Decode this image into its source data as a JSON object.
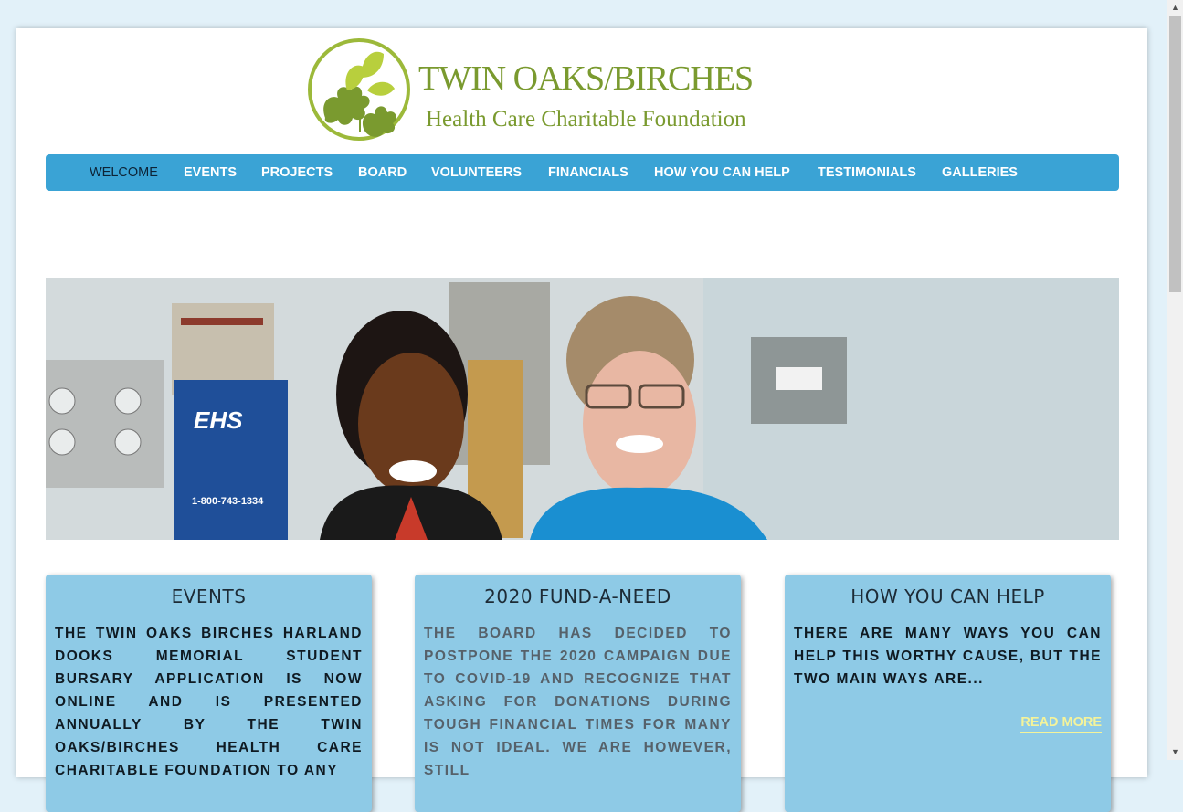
{
  "logo": {
    "title": "TWIN OAKS/BIRCHES",
    "subtitle": "Health Care Charitable Foundation"
  },
  "nav": {
    "items": [
      {
        "label": "WELCOME",
        "active": true
      },
      {
        "label": "EVENTS"
      },
      {
        "label": "PROJECTS"
      },
      {
        "label": "BOARD"
      },
      {
        "label": "VOLUNTEERS"
      },
      {
        "label": "FINANCIALS"
      },
      {
        "label": "HOW YOU CAN HELP"
      },
      {
        "label": "TESTIMONIALS"
      },
      {
        "label": "GALLERIES"
      }
    ]
  },
  "hero": {
    "sign_text": "EHS",
    "phone_text": "1-800-743-1334"
  },
  "cards": [
    {
      "title": "EVENTS",
      "body": "THE TWIN OAKS BIRCHES HARLAND DOOKS MEMORIAL STUDENT BURSARY APPLICATION IS NOW ONLINE AND IS PRESENTED ANNUALLY BY THE TWIN OAKS/BIRCHES HEALTH CARE CHARITABLE FOUNDATION TO ANY"
    },
    {
      "title": "2020 FUND-A-NEED",
      "body": "THE BOARD HAS DECIDED TO POSTPONE THE 2020 CAMPAIGN DUE TO COVID-19  AND RECOGNIZE THAT ASKING FOR DONATIONS DURING TOUGH FINANCIAL TIMES FOR MANY IS NOT IDEAL.  WE ARE HOWEVER, STILL"
    },
    {
      "title": "HOW YOU CAN HELP",
      "body": "THERE ARE MANY WAYS YOU CAN HELP THIS WORTHY CAUSE, BUT THE TWO MAIN WAYS ARE...",
      "link": "READ MORE"
    }
  ],
  "colors": {
    "nav_bg": "#3aa3d5",
    "card_bg": "#8ecae6",
    "logo_green": "#7a9a2f",
    "read_more": "#f4f39a",
    "page_bg": "#e2f1f9"
  },
  "icons": {
    "scroll_up": "scroll-up-arrow-icon",
    "scroll_down": "scroll-down-arrow-icon",
    "logo": "oak-birch-leaf-logo-icon"
  }
}
